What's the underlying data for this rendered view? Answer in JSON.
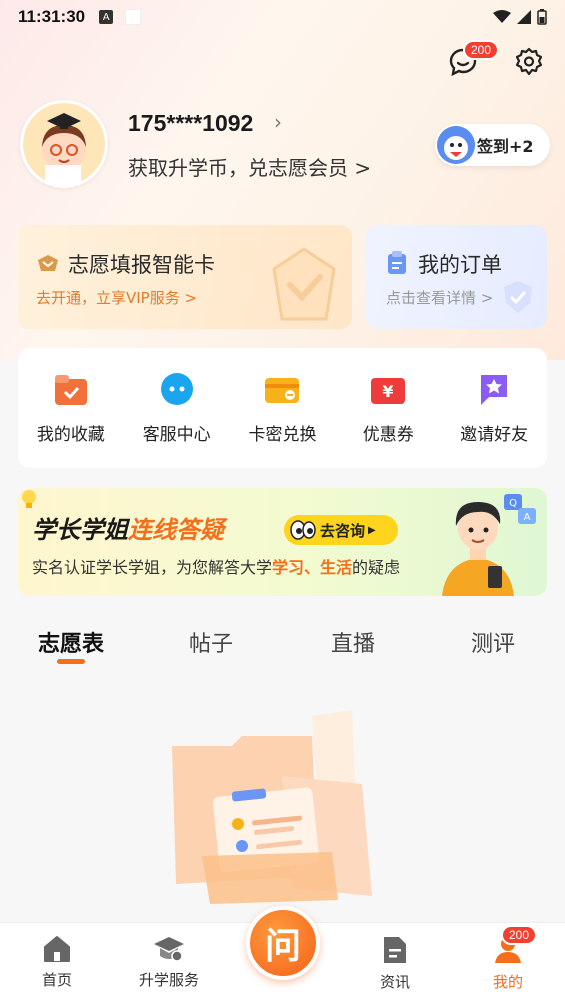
{
  "status_bar": {
    "time": "11:31:30",
    "a_icon": "A"
  },
  "header": {
    "messages_badge": "200"
  },
  "profile": {
    "phone": "175****1092",
    "tagline": "获取升学币，兑志愿会员 >",
    "signin_label": "签到+2"
  },
  "cards": {
    "vip": {
      "title": "志愿填报智能卡",
      "subtitle": "去开通，立享VIP服务 >"
    },
    "order": {
      "title": "我的订单",
      "subtitle": "点击查看详情 >"
    }
  },
  "quick_actions": [
    {
      "label": "我的收藏",
      "icon": "folder-check-icon",
      "color": "#f2713b"
    },
    {
      "label": "客服中心",
      "icon": "chat-bubble-icon",
      "color": "#1aa6ef"
    },
    {
      "label": "卡密兑换",
      "icon": "card-exchange-icon",
      "color": "#f7b21a"
    },
    {
      "label": "优惠券",
      "icon": "coupon-icon",
      "color": "#ef3b3b"
    },
    {
      "label": "邀请好友",
      "icon": "star-flag-icon",
      "color": "#8a5cf5"
    }
  ],
  "banner": {
    "title_part1": "学长学姐",
    "title_part2": "连线答疑",
    "cta": "去咨询",
    "desc_prefix": "实名认证学长学姐，为您解答大学",
    "desc_highlight": "学习、生活",
    "desc_suffix": "的疑虑"
  },
  "tabs": [
    "志愿表",
    "帖子",
    "直播",
    "测评"
  ],
  "bottom_nav": {
    "items": [
      "首页",
      "升学服务",
      "资讯",
      "我的"
    ],
    "center_label": "问",
    "mine_badge": "200"
  },
  "colors": {
    "accent": "#f46f1b",
    "badge": "#f2402f"
  }
}
